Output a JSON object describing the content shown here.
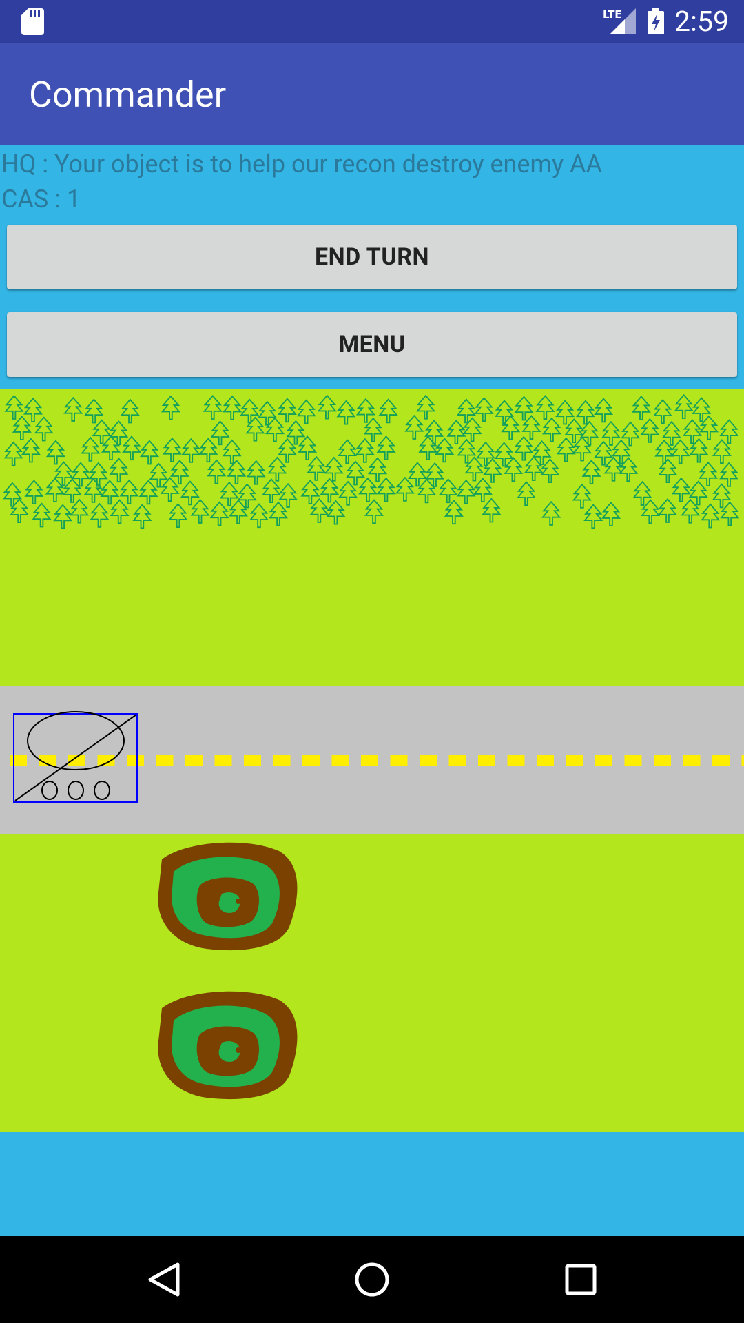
{
  "status_bar": {
    "time": "2:59",
    "network": "LTE",
    "icons": [
      "sd-card-icon",
      "lte-signal-icon",
      "battery-charging-icon"
    ]
  },
  "app_bar": {
    "title": "Commander"
  },
  "mission": {
    "hq_message": "HQ : Your object is to help our recon destroy enemy AA",
    "cas_label": "CAS : 1"
  },
  "buttons": {
    "end_turn": "END TURN",
    "menu": "MENU"
  },
  "game_board": {
    "terrain": [
      "forest",
      "grass",
      "road",
      "grass"
    ],
    "units": [
      {
        "type": "recon-wheeled-unit",
        "selected": true
      }
    ],
    "hills": 2
  },
  "nav_bar": {
    "icons": [
      "back-icon",
      "home-icon",
      "recents-icon"
    ]
  },
  "colors": {
    "status_bar": "#303f9f",
    "app_bar": "#3f51b5",
    "background": "#33b5e5",
    "grass": "#b4e61e",
    "road": "#c3c3c3",
    "road_line": "#ffee00",
    "tree": "#15a05a",
    "hill_outer": "#7a4100",
    "hill_inner": "#23b14d",
    "unit_select": "#0000ff"
  }
}
